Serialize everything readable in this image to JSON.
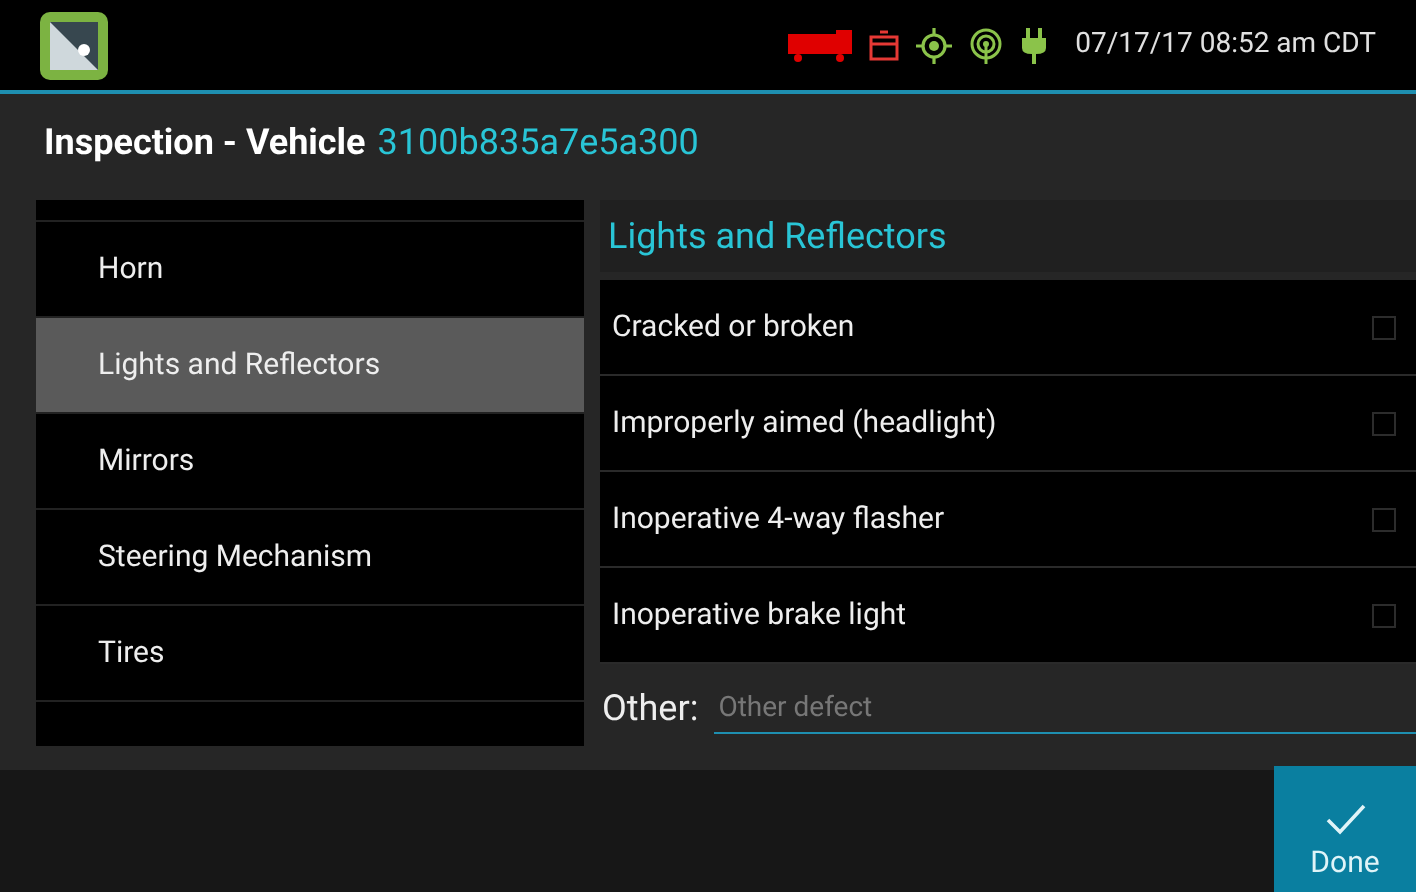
{
  "status_bar": {
    "datetime": "07/17/17 08:52 am CDT"
  },
  "header": {
    "title": "Inspection - Vehicle",
    "vehicle_id": "3100b835a7e5a300"
  },
  "categories": [
    {
      "label": "Horn",
      "selected": false
    },
    {
      "label": "Lights and Reflectors",
      "selected": true
    },
    {
      "label": "Mirrors",
      "selected": false
    },
    {
      "label": "Steering Mechanism",
      "selected": false
    },
    {
      "label": "Tires",
      "selected": false
    }
  ],
  "section": {
    "title": "Lights and Reflectors"
  },
  "defects": [
    {
      "label": "Cracked or broken",
      "checked": false
    },
    {
      "label": "Improperly aimed (headlight)",
      "checked": false
    },
    {
      "label": "Inoperative 4-way flasher",
      "checked": false
    },
    {
      "label": "Inoperative brake light",
      "checked": false
    }
  ],
  "other": {
    "label": "Other:",
    "placeholder": "Other defect"
  },
  "done_button": {
    "label": "Done"
  }
}
